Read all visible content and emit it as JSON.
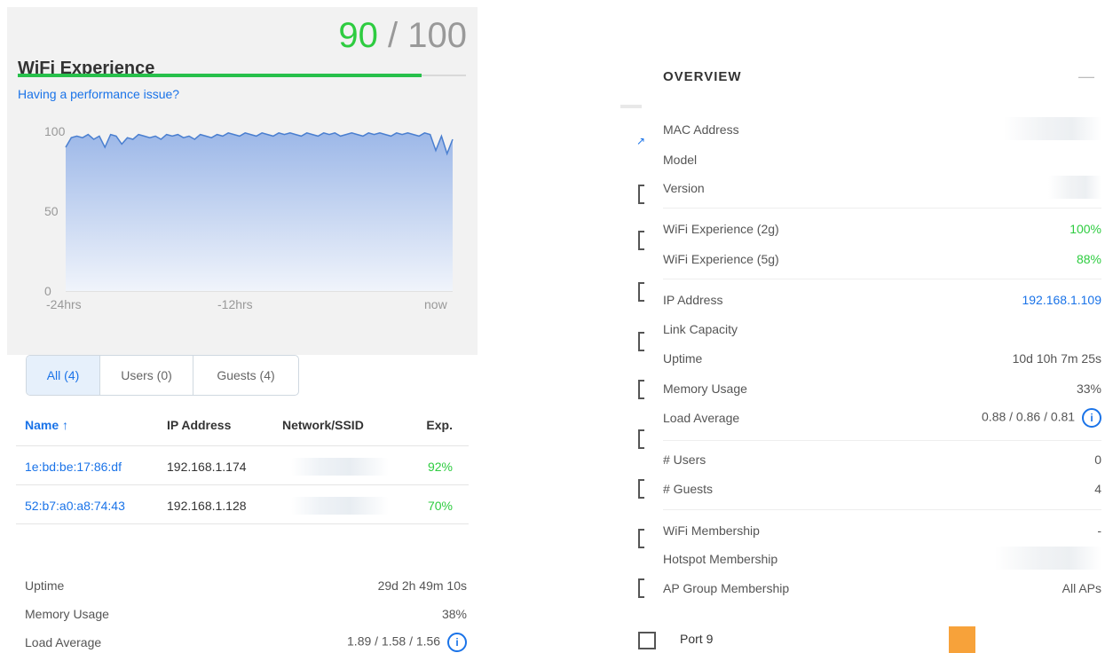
{
  "wifi_experience": {
    "title": "WiFi Experience",
    "score": "90",
    "separator": "/",
    "max": "100",
    "score_fraction": 0.9,
    "perf_link": "Having a performance issue?",
    "color_fill": "#27c04b"
  },
  "chart_data": {
    "type": "area",
    "ylim": [
      0,
      100
    ],
    "y_ticks": [
      "100",
      "50",
      "0"
    ],
    "x_ticks": [
      "-24hrs",
      "-12hrs",
      "now"
    ],
    "series": [
      {
        "values": [
          90,
          96,
          97,
          96,
          98,
          95,
          97,
          90,
          98,
          97,
          92,
          96,
          95,
          98,
          97,
          96,
          97,
          95,
          98,
          97,
          98,
          96,
          97,
          95,
          98,
          97,
          96,
          98,
          97,
          99,
          98,
          97,
          99,
          98,
          97,
          99,
          98,
          97,
          99,
          98,
          99,
          98,
          97,
          99,
          98,
          97,
          99,
          98,
          99,
          97,
          98,
          99,
          98,
          97,
          99,
          98,
          99,
          98,
          97,
          99,
          98,
          99,
          98,
          97,
          99,
          98,
          88,
          97,
          86,
          95
        ]
      }
    ],
    "line_color": "#4a7fd0",
    "fill_top": "#9db8e8",
    "fill_bottom": "#f0f4fb"
  },
  "tabs": [
    {
      "label": "All (4)",
      "active": true
    },
    {
      "label": "Users (0)",
      "active": false
    },
    {
      "label": "Guests (4)",
      "active": false
    }
  ],
  "clients": {
    "headers": {
      "name": "Name ↑",
      "ip": "IP Address",
      "network": "Network/SSID",
      "exp": "Exp."
    },
    "rows": [
      {
        "name": "1e:bd:be:17:86:df",
        "ip": "192.168.1.174",
        "exp": "92%"
      },
      {
        "name": "52:b7:a0:a8:74:43",
        "ip": "192.168.1.128",
        "exp": "70%"
      }
    ]
  },
  "left_stats": {
    "uptime_label": "Uptime",
    "uptime_value": "29d 2h 49m 10s",
    "memory_label": "Memory Usage",
    "memory_value": "38%",
    "load_label": "Load Average",
    "load_value": "1.89 / 1.58 / 1.56",
    "info_glyph": "i"
  },
  "overview": {
    "title": "OVERVIEW",
    "collapse": "—",
    "left_accent": "↗",
    "rows": {
      "mac_label": "MAC Address",
      "model_label": "Model",
      "version_label": "Version",
      "wifi_2g_label": "WiFi Experience (2g)",
      "wifi_2g_value": "100%",
      "wifi_5g_label": "WiFi Experience (5g)",
      "wifi_5g_value": "88%",
      "ip_label": "IP Address",
      "ip_value": "192.168.1.109",
      "link_label": "Link Capacity",
      "uptime_label": "Uptime",
      "uptime_value": "10d 10h 7m 25s",
      "memory_label": "Memory Usage",
      "memory_value": "33%",
      "load_label": "Load Average",
      "load_value": "0.88 / 0.86 / 0.81",
      "users_label": "# Users",
      "users_value": "0",
      "guests_label": "# Guests",
      "guests_value": "4",
      "wifi_membership_label": "WiFi Membership",
      "wifi_membership_value": "-",
      "hotspot_label": "Hotspot Membership",
      "ap_group_label": "AP Group Membership",
      "ap_group_value": "All APs"
    },
    "port_label": "Port 9",
    "port_color": "#f7a23a"
  }
}
